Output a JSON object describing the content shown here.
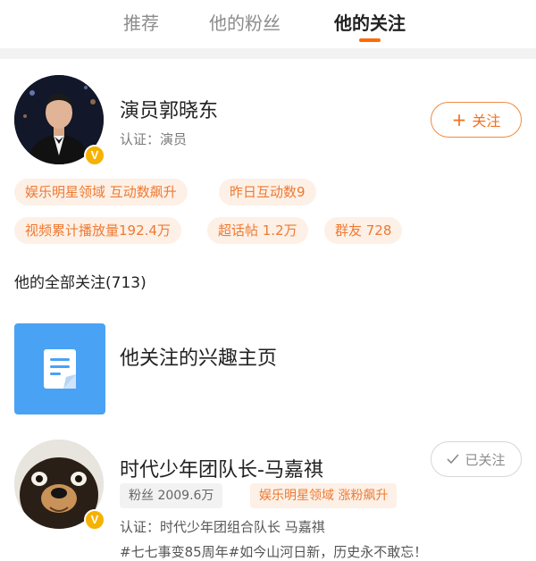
{
  "tabs": [
    {
      "label": "推荐",
      "active": false
    },
    {
      "label": "他的粉丝",
      "active": false
    },
    {
      "label": "他的关注",
      "active": true
    }
  ],
  "profile": {
    "name": "演员郭晓东",
    "verification": "认证：演员",
    "follow_label": "关注",
    "tags": [
      "娱乐明星领域 互动数飙升",
      "昨日互动数9",
      "视频累计播放量192.4万",
      "超话帖 1.2万",
      "群友 728"
    ]
  },
  "following_section": {
    "title": "他的全部关注(713)"
  },
  "interest": {
    "label": "他关注的兴趣主页"
  },
  "followed_user": {
    "name": "时代少年团队长-马嘉祺",
    "followed_label": "已关注",
    "fans": "粉丝 2009.6万",
    "hot_tag": "娱乐明星领域 涨粉飙升",
    "verification": "认证：时代少年团组合队长 马嘉祺",
    "bio": "#七七事变85周年#如今山河日新，历史永不敢忘！"
  },
  "colors": {
    "accent": "#ff6a00",
    "tag_bg": "#fdf0e6",
    "tag_text": "#ee7a33",
    "verified_badge": "#f6b200",
    "interest_icon_bg": "#4aa2f4"
  },
  "icons": {
    "plus": "plus-icon",
    "check": "check-icon",
    "verified": "verified-v-icon",
    "document": "document-icon"
  }
}
